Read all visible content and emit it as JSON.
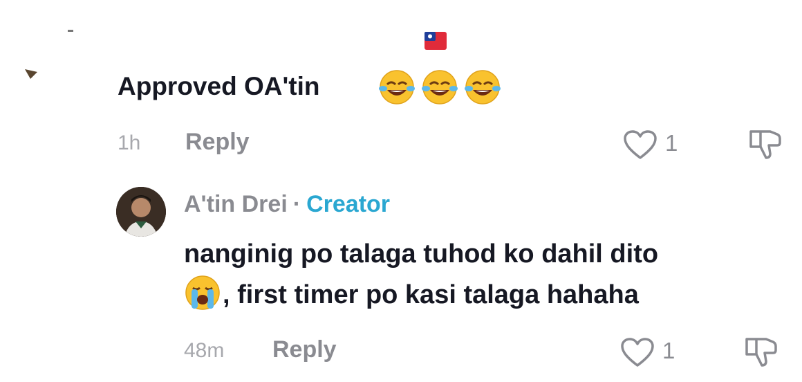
{
  "parent_comment": {
    "text": "Approved OA'tin",
    "emojis": [
      "face-with-tears-of-joy",
      "face-with-tears-of-joy",
      "face-with-tears-of-joy"
    ],
    "time": "1h",
    "reply_label": "Reply",
    "like_count": "1",
    "flag_icon": "flag-icon"
  },
  "reply_comment": {
    "author": "A'tin Drei",
    "separator": "·",
    "badge": "Creator",
    "text_line1": "nanginig po talaga tuhod ko dahil dito",
    "text_line2": ", first timer po kasi talaga hahaha",
    "emoji": "loudly-crying-face",
    "time": "48m",
    "reply_label": "Reply",
    "like_count": "1"
  },
  "colors": {
    "text": "#161823",
    "muted": "#8a8b91",
    "creator_badge": "#2aa7d1"
  }
}
